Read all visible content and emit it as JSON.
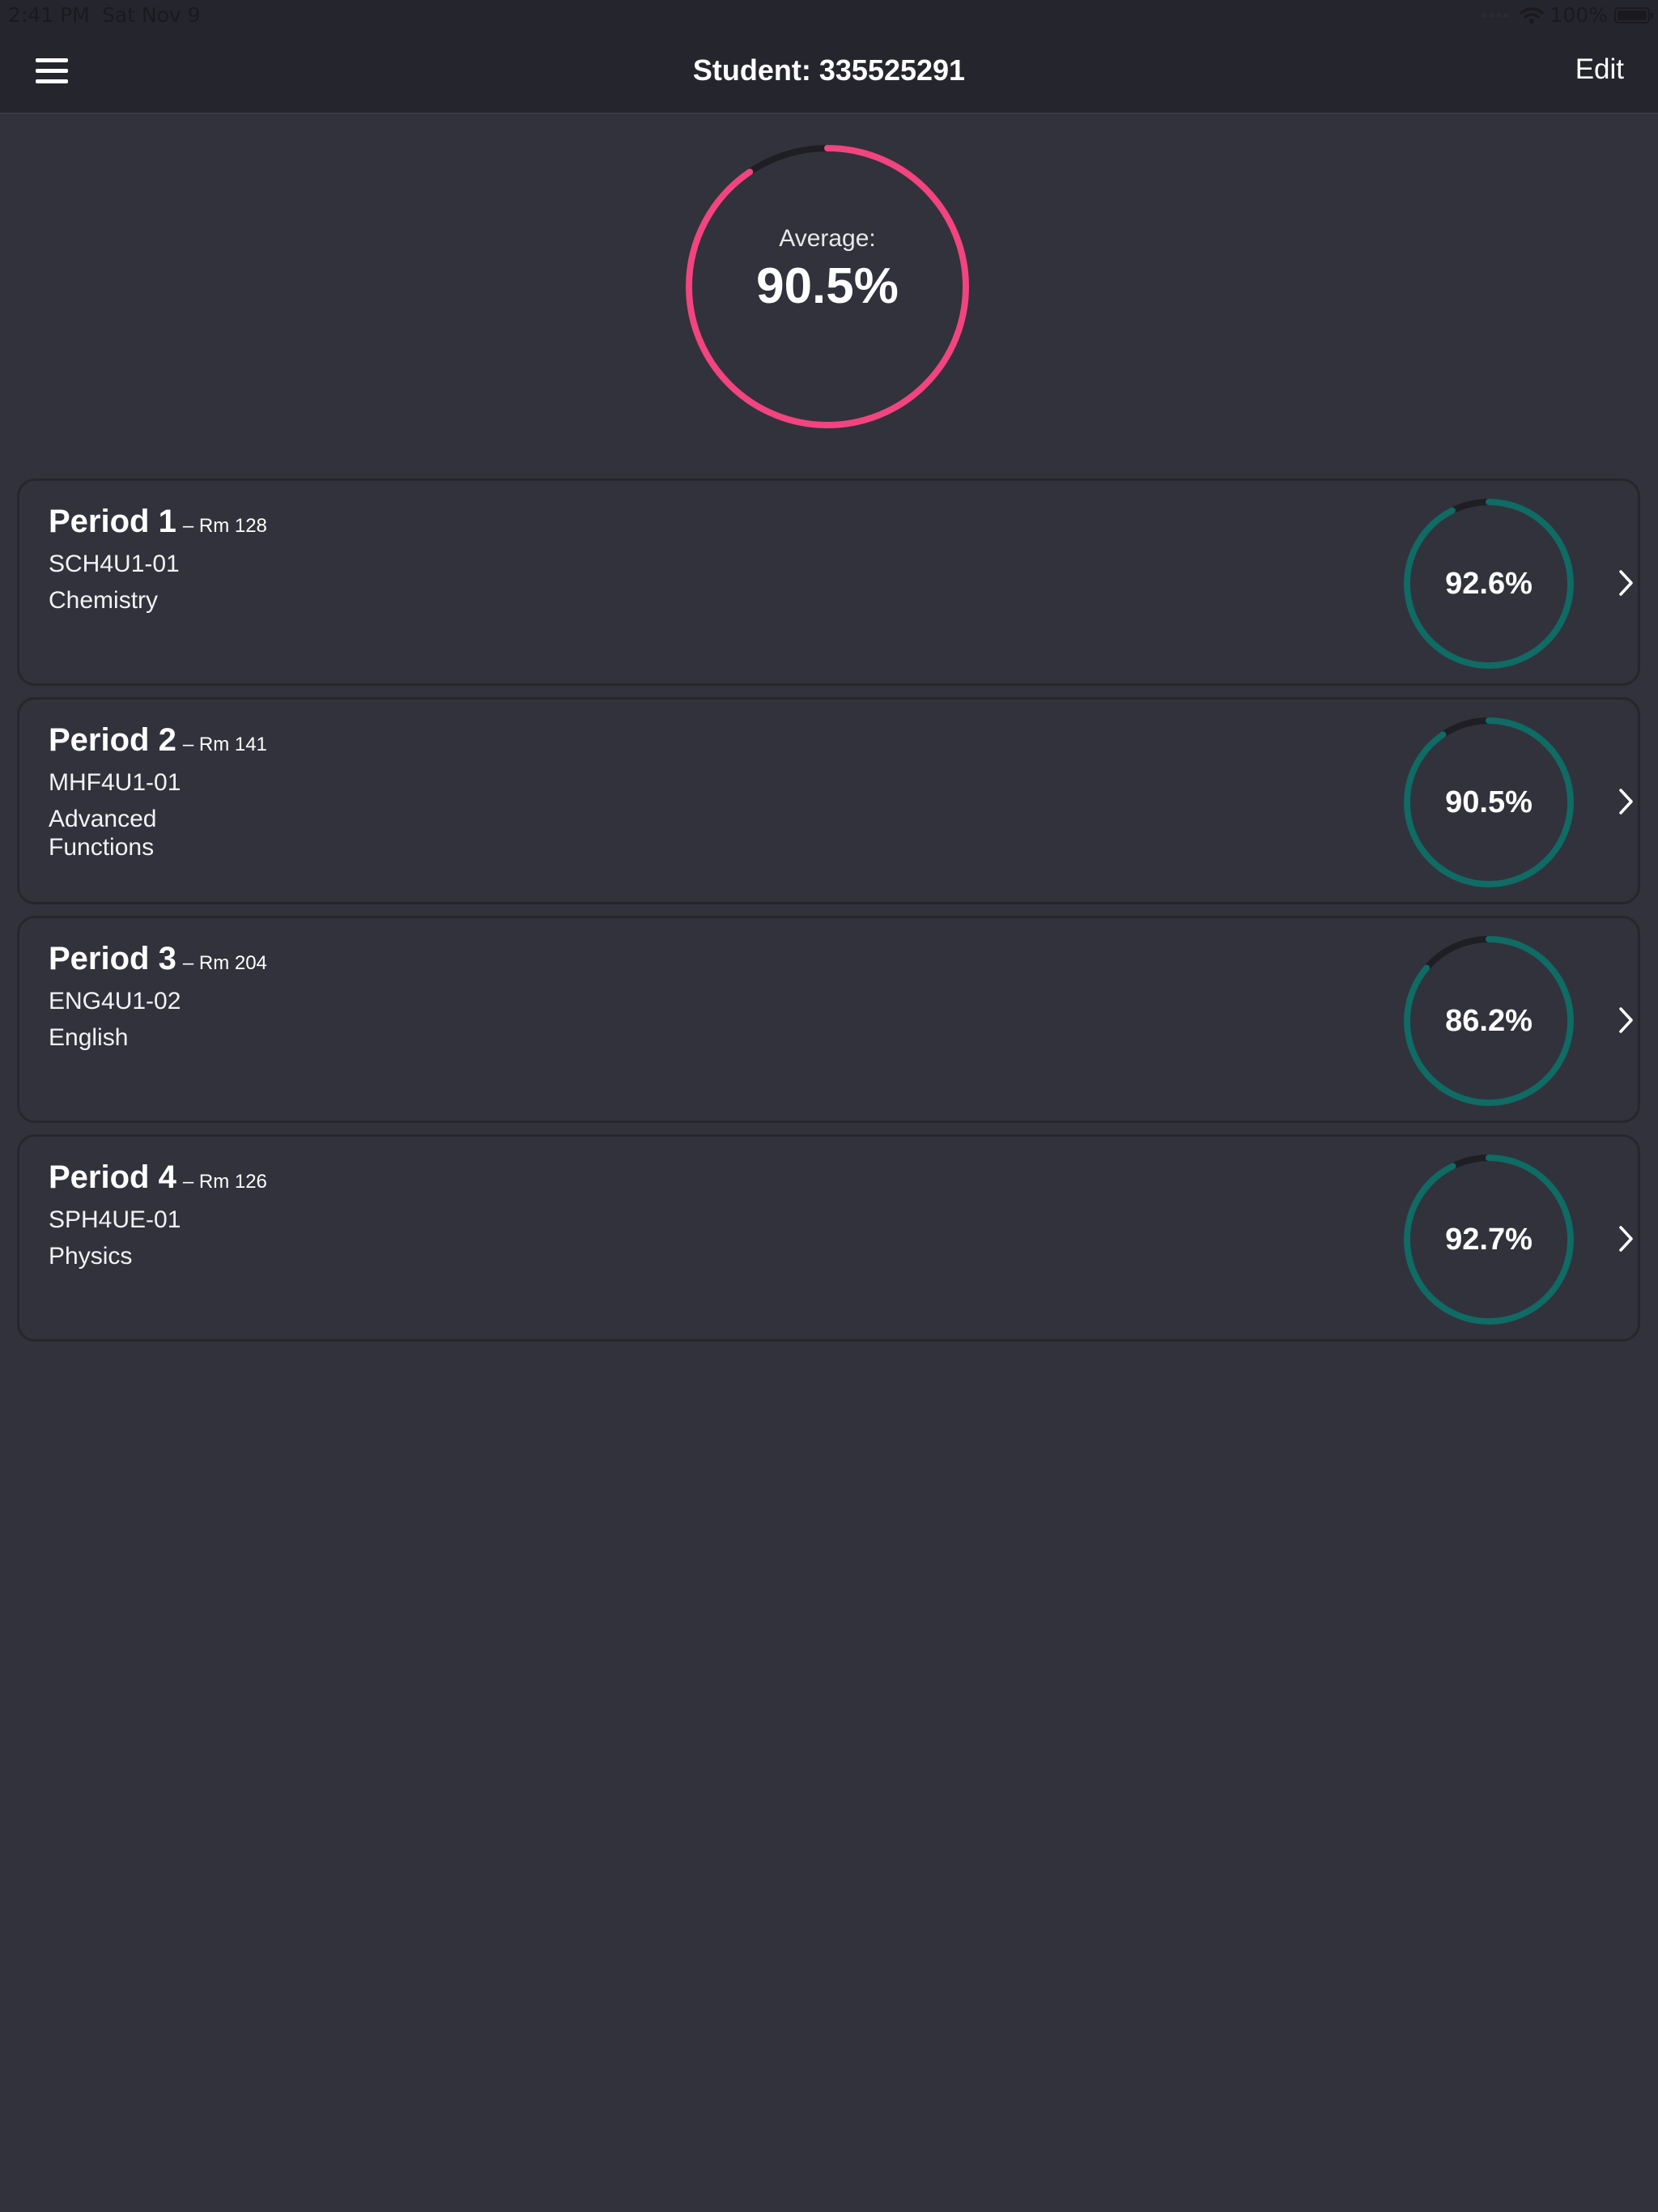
{
  "status_bar": {
    "time": "2:41 PM",
    "date": "Sat Nov 9",
    "battery": "100%",
    "icons": [
      "cellular-signal-icon",
      "wifi-icon",
      "battery-icon"
    ]
  },
  "header": {
    "title": "Student: 335525291",
    "edit_label": "Edit",
    "menu_icon": "hamburger-menu-icon"
  },
  "average": {
    "label": "Average:",
    "value_text": "90.5%",
    "percent": 90.5,
    "color": "#f2447f"
  },
  "courses": [
    {
      "period": "Period 1",
      "room": "– Rm 128",
      "code": "SCH4U1-01",
      "subject": "Chemistry",
      "grade_text": "92.6%",
      "percent": 92.6
    },
    {
      "period": "Period 2",
      "room": "– Rm 141",
      "code": "MHF4U1-01",
      "subject": "Advanced Functions",
      "grade_text": "90.5%",
      "percent": 90.5
    },
    {
      "period": "Period 3",
      "room": "– Rm 204",
      "code": "ENG4U1-02",
      "subject": "English",
      "grade_text": "86.2%",
      "percent": 86.2
    },
    {
      "period": "Period 4",
      "room": "– Rm 126",
      "code": "SPH4UE-01",
      "subject": "Physics",
      "grade_text": "92.7%",
      "percent": 92.7
    }
  ],
  "colors": {
    "background": "#32323c",
    "nav_background": "#25252d",
    "accent_pink": "#f2447f",
    "course_ring": "#0f6b64",
    "ring_track": "#1e1e24"
  }
}
